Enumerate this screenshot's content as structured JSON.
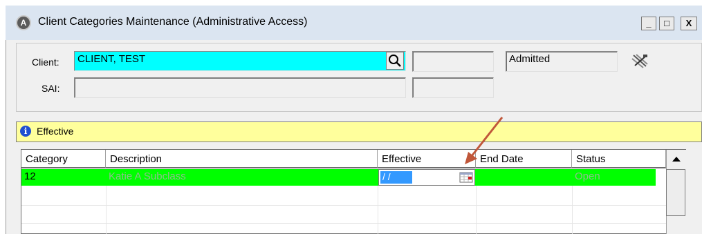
{
  "window": {
    "icon_letter": "A",
    "title": "Client Categories Maintenance (Administrative Access)",
    "minimize": "_",
    "maximize": "□",
    "close": "X"
  },
  "header": {
    "client_label": "Client:",
    "client_value": "CLIENT, TEST",
    "status_field": "Admitted",
    "sai_label": "SAI:"
  },
  "banner": {
    "icon": "info-icon",
    "text": "Effective"
  },
  "table": {
    "columns": [
      "Category",
      "Description",
      "Effective",
      "End Date",
      "Status"
    ],
    "rows": [
      {
        "category": "12",
        "description": "Katie A Subclass",
        "effective": "/ /",
        "end_date": "",
        "status": "Open"
      }
    ]
  },
  "colors": {
    "client_highlight": "#00ffff",
    "row_highlight": "#00ff00",
    "banner_bg": "#ffff9c",
    "annotation_arrow": "#c0573a"
  }
}
